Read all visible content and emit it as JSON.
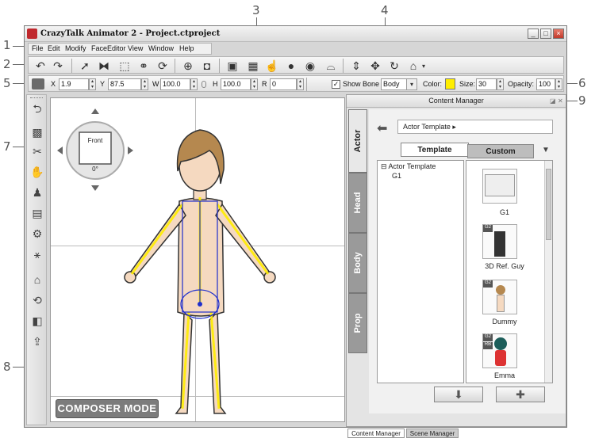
{
  "window": {
    "title": "CrazyTalk Animator 2  - Project.ctproject",
    "controls": [
      "_",
      "□",
      "×"
    ]
  },
  "callouts": [
    "1",
    "2",
    "3",
    "4",
    "5",
    "6",
    "7",
    "8",
    "9"
  ],
  "menubar": [
    "File",
    "Edit",
    "Modify",
    "FaceEditor",
    "View",
    "Window",
    "Help"
  ],
  "propbar": {
    "x_label": "X",
    "x_value": "1.9",
    "y_label": "Y",
    "y_value": "87.5",
    "w_label": "W",
    "w_value": "100.0",
    "h_label": "H",
    "h_value": "100.0",
    "r_label": "R",
    "r_value": "0",
    "show_bone_label": "Show Bone",
    "bone_select": "Body",
    "color_label": "Color:",
    "size_label": "Size:",
    "size_value": "30",
    "opacity_label": "Opacity:",
    "opacity_value": "100"
  },
  "canvas": {
    "view_label": "Front",
    "view_angle": "0°",
    "mode_label": "COMPOSER MODE"
  },
  "content_manager": {
    "title": "Content Manager",
    "vertical_tabs": [
      "Actor",
      "Head",
      "Body",
      "Prop"
    ],
    "breadcrumb": "Actor Template",
    "tabs": [
      "Template",
      "Custom"
    ],
    "tree": {
      "root": "Actor Template",
      "child": "G1"
    },
    "items": [
      {
        "label": "G1"
      },
      {
        "label": "3D Ref. Guy",
        "badge": "G2"
      },
      {
        "label": "Dummy",
        "badge": "G2"
      },
      {
        "label": "Emma",
        "badge": "G2",
        "badge2": "RB"
      }
    ]
  },
  "bottom_tabs": [
    "Content Manager",
    "Scene Manager"
  ],
  "colors": {
    "bone_color": "#ffee00",
    "tab_inactive": "#9a9a9a"
  }
}
